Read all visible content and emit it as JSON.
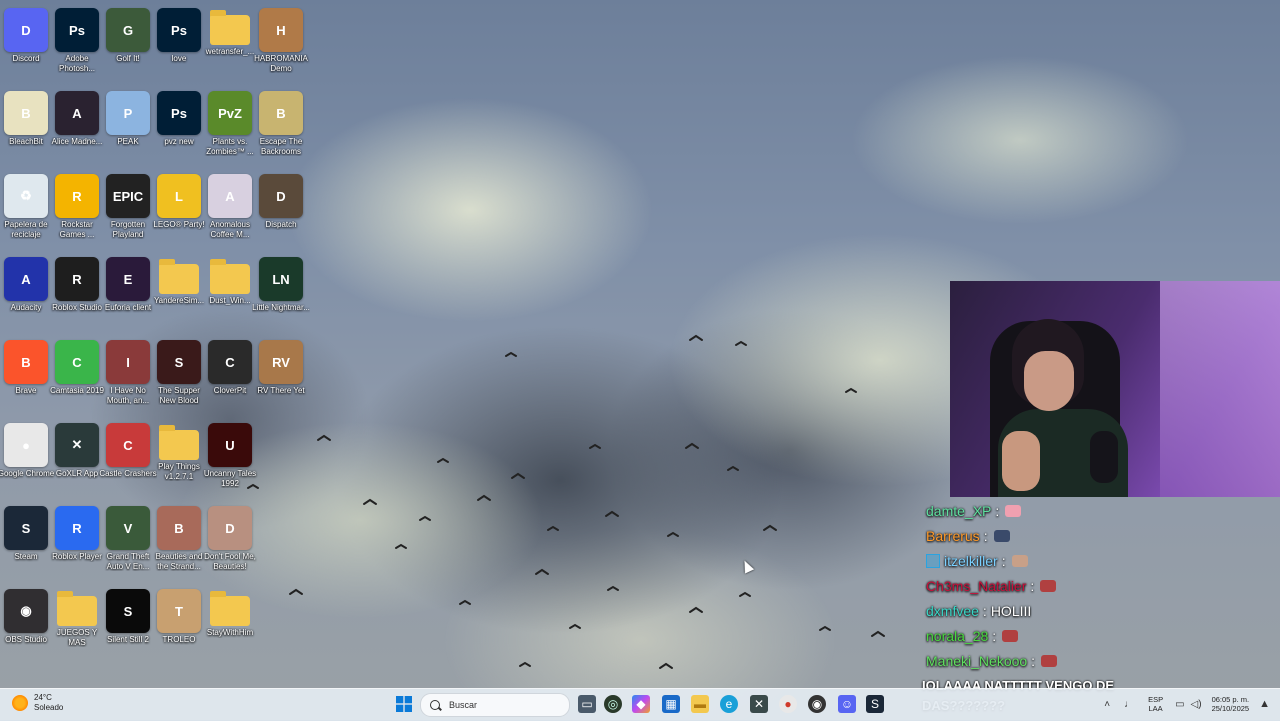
{
  "desktop_icons": [
    {
      "label": "Discord",
      "col": 0,
      "row": 0,
      "color": "#5865f2",
      "glyph": "D"
    },
    {
      "label": "Adobe Photosh...",
      "col": 1,
      "row": 0,
      "color": "#001e36",
      "glyph": "Ps"
    },
    {
      "label": "Golf It!",
      "col": 2,
      "row": 0,
      "color": "#3c5a3a",
      "glyph": "G"
    },
    {
      "label": "love",
      "col": 3,
      "row": 0,
      "color": "#001e36",
      "glyph": "Ps"
    },
    {
      "label": "wetransfer_...",
      "col": 4,
      "row": 0,
      "color": "folder",
      "glyph": ""
    },
    {
      "label": "HABROMANIA Demo",
      "col": 5,
      "row": 0,
      "color": "#b07a48",
      "glyph": "H"
    },
    {
      "label": "BleachBit",
      "col": 0,
      "row": 1,
      "color": "#e8e2c0",
      "glyph": "B"
    },
    {
      "label": "Alice Madne...",
      "col": 1,
      "row": 1,
      "color": "#2a2230",
      "glyph": "A"
    },
    {
      "label": "PEAK",
      "col": 2,
      "row": 1,
      "color": "#8cb4e0",
      "glyph": "P"
    },
    {
      "label": "pvz new",
      "col": 3,
      "row": 1,
      "color": "#001e36",
      "glyph": "Ps"
    },
    {
      "label": "Plants vs. Zombies™ ...",
      "col": 4,
      "row": 1,
      "color": "#5a8a2a",
      "glyph": "PvZ"
    },
    {
      "label": "Escape The Backrooms",
      "col": 5,
      "row": 1,
      "color": "#c8b470",
      "glyph": "B"
    },
    {
      "label": "Papelera de reciclaje",
      "col": 0,
      "row": 2,
      "color": "#dfe8ee",
      "glyph": "♻"
    },
    {
      "label": "Rockstar Games ...",
      "col": 1,
      "row": 2,
      "color": "#f4b400",
      "glyph": "R"
    },
    {
      "label": "Forgotten Playland",
      "col": 2,
      "row": 2,
      "color": "#222222",
      "glyph": "EPIC"
    },
    {
      "label": "LEGO® Party!",
      "col": 3,
      "row": 2,
      "color": "#f0c020",
      "glyph": "L"
    },
    {
      "label": "Anomalous Coffee M...",
      "col": 4,
      "row": 2,
      "color": "#d8d0e0",
      "glyph": "A"
    },
    {
      "label": "Dispatch",
      "col": 5,
      "row": 2,
      "color": "#5a4a3a",
      "glyph": "D"
    },
    {
      "label": "Audacity",
      "col": 0,
      "row": 3,
      "color": "#2233aa",
      "glyph": "A"
    },
    {
      "label": "Roblox Studio",
      "col": 1,
      "row": 3,
      "color": "#1e1e1e",
      "glyph": "R"
    },
    {
      "label": "Euforia client",
      "col": 2,
      "row": 3,
      "color": "#2a1a3a",
      "glyph": "E"
    },
    {
      "label": "YandereSim...",
      "col": 3,
      "row": 3,
      "color": "folder",
      "glyph": ""
    },
    {
      "label": "Dust_Win...",
      "col": 4,
      "row": 3,
      "color": "folder",
      "glyph": ""
    },
    {
      "label": "Little Nightmar...",
      "col": 5,
      "row": 3,
      "color": "#1a3a2a",
      "glyph": "LN"
    },
    {
      "label": "Brave",
      "col": 0,
      "row": 4,
      "color": "#fb542b",
      "glyph": "B"
    },
    {
      "label": "Camtasia 2019",
      "col": 1,
      "row": 4,
      "color": "#3ab54a",
      "glyph": "C"
    },
    {
      "label": "I Have No Mouth, an...",
      "col": 2,
      "row": 4,
      "color": "#8a3a3a",
      "glyph": "I"
    },
    {
      "label": "The Supper New Blood",
      "col": 3,
      "row": 4,
      "color": "#3a1a1a",
      "glyph": "S"
    },
    {
      "label": "CloverPit",
      "col": 4,
      "row": 4,
      "color": "#2a2a2a",
      "glyph": "C"
    },
    {
      "label": "RV There Yet",
      "col": 5,
      "row": 4,
      "color": "#a8784a",
      "glyph": "RV"
    },
    {
      "label": "Google Chrome",
      "col": 0,
      "row": 5,
      "color": "#e8e8e8",
      "glyph": "●"
    },
    {
      "label": "GoXLR App",
      "col": 1,
      "row": 5,
      "color": "#2a3a3a",
      "glyph": "✕"
    },
    {
      "label": "Castle Crashers",
      "col": 2,
      "row": 5,
      "color": "#c83a3a",
      "glyph": "C"
    },
    {
      "label": "Play Things v1.2.7.1",
      "col": 3,
      "row": 5,
      "color": "folder",
      "glyph": ""
    },
    {
      "label": "Uncanny Tales 1992",
      "col": 4,
      "row": 5,
      "color": "#3a0a0a",
      "glyph": "U"
    },
    {
      "label": "Steam",
      "col": 0,
      "row": 6,
      "color": "#1b2838",
      "glyph": "S"
    },
    {
      "label": "Roblox Player",
      "col": 1,
      "row": 6,
      "color": "#2a6af0",
      "glyph": "R"
    },
    {
      "label": "Grand Theft Auto V En...",
      "col": 2,
      "row": 6,
      "color": "#3a5a3a",
      "glyph": "V"
    },
    {
      "label": "Beauties and the Strand...",
      "col": 3,
      "row": 6,
      "color": "#a86a5a",
      "glyph": "B"
    },
    {
      "label": "Don't Fool Me, Beauties!",
      "col": 4,
      "row": 6,
      "color": "#b89080",
      "glyph": "D"
    },
    {
      "label": "OBS Studio",
      "col": 0,
      "row": 7,
      "color": "#302e31",
      "glyph": "◉"
    },
    {
      "label": "JUEGOS Y MAS",
      "col": 1,
      "row": 7,
      "color": "folder",
      "glyph": ""
    },
    {
      "label": "Silent Still 2",
      "col": 2,
      "row": 7,
      "color": "#0a0a0a",
      "glyph": "S"
    },
    {
      "label": "TROLEO",
      "col": 3,
      "row": 7,
      "color": "#c8a070",
      "glyph": "T"
    },
    {
      "label": "StayWithHim",
      "col": 4,
      "row": 7,
      "color": "folder",
      "glyph": ""
    }
  ],
  "chat": [
    {
      "user": "damte_XP",
      "message": "",
      "color": "#5fe0a0",
      "emote": "#f0a0b0",
      "badge": false
    },
    {
      "user": "Barrerus",
      "message": "",
      "color": "#ff9a2a",
      "emote": "#3a4a6a",
      "badge": false
    },
    {
      "user": "itzelkiller",
      "message": "",
      "color": "#7ad0ff",
      "emote": "#c8a088",
      "badge": true
    },
    {
      "user": "Ch3ms_Natalier",
      "message": "",
      "color": "#c8103a",
      "emote": "#b04040",
      "badge": false
    },
    {
      "user": "dxmfvee",
      "message": "HOLIII",
      "color": "#3ad8c8",
      "emote": "",
      "badge": false
    },
    {
      "user": "norala_28",
      "message": "",
      "color": "#4ad840",
      "emote": "#b04040",
      "badge": false
    },
    {
      "user": "Maneki_Nekooo",
      "message": "",
      "color": "#60e060",
      "emote": "#b04040",
      "badge": false
    }
  ],
  "chat_long_message": "IOLAAAA NATTTTT VENGO DE DAS???????",
  "taskbar": {
    "weather_temp": "24°C",
    "weather_desc": "Soleado",
    "search_placeholder": "Buscar",
    "lang_top": "ESP",
    "lang_bottom": "LAA",
    "time": "06:05 p. m.",
    "date": "25/10/2025"
  },
  "colors": {
    "taskbar_bg": "#e4ecf2",
    "start_blue": "#0a7ad8",
    "folder": "#f3c84f"
  }
}
